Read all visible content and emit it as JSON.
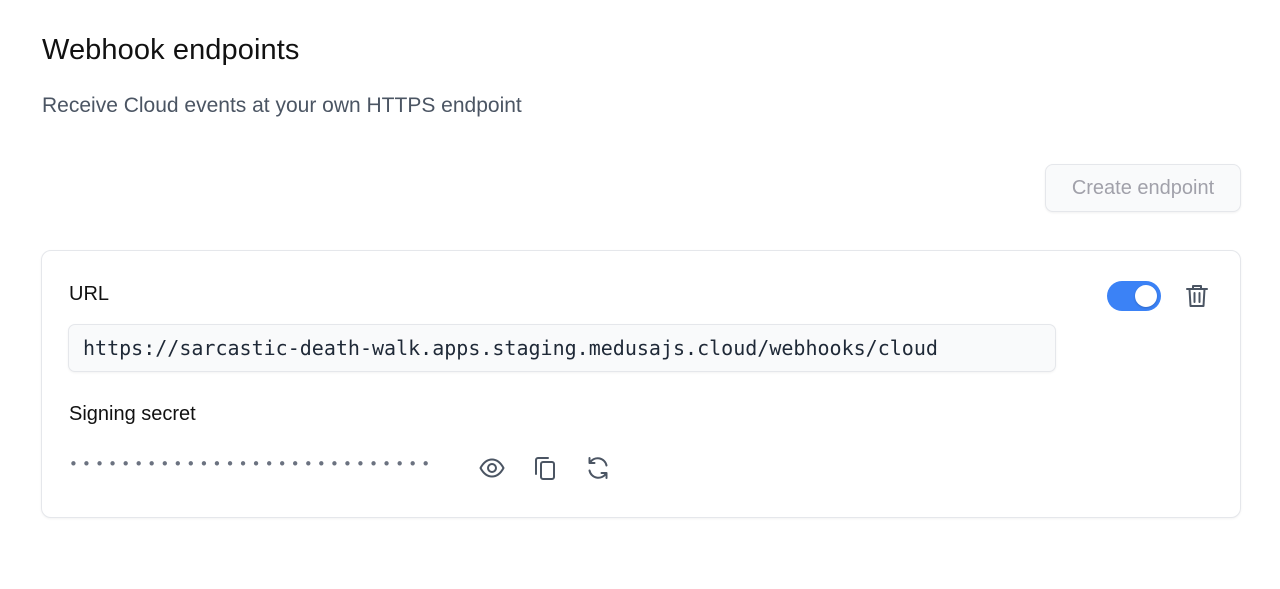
{
  "header": {
    "title": "Webhook endpoints",
    "subtitle": "Receive Cloud events at your own HTTPS endpoint"
  },
  "actions": {
    "create_label": "Create endpoint"
  },
  "endpoint": {
    "url_label": "URL",
    "url_value": "https://sarcastic-death-walk.apps.staging.medusajs.cloud/webhooks/cloud",
    "enabled": true,
    "secret_label": "Signing secret",
    "secret_masked": "••••••••••••••••••••••••••••"
  },
  "icons": {
    "delete": "trash-icon",
    "reveal": "eye-icon",
    "copy": "copy-icon",
    "regenerate": "refresh-icon"
  },
  "colors": {
    "toggle_on": "#3b82f6",
    "muted_text": "#4b5563",
    "disabled_text": "#a1a1aa"
  }
}
